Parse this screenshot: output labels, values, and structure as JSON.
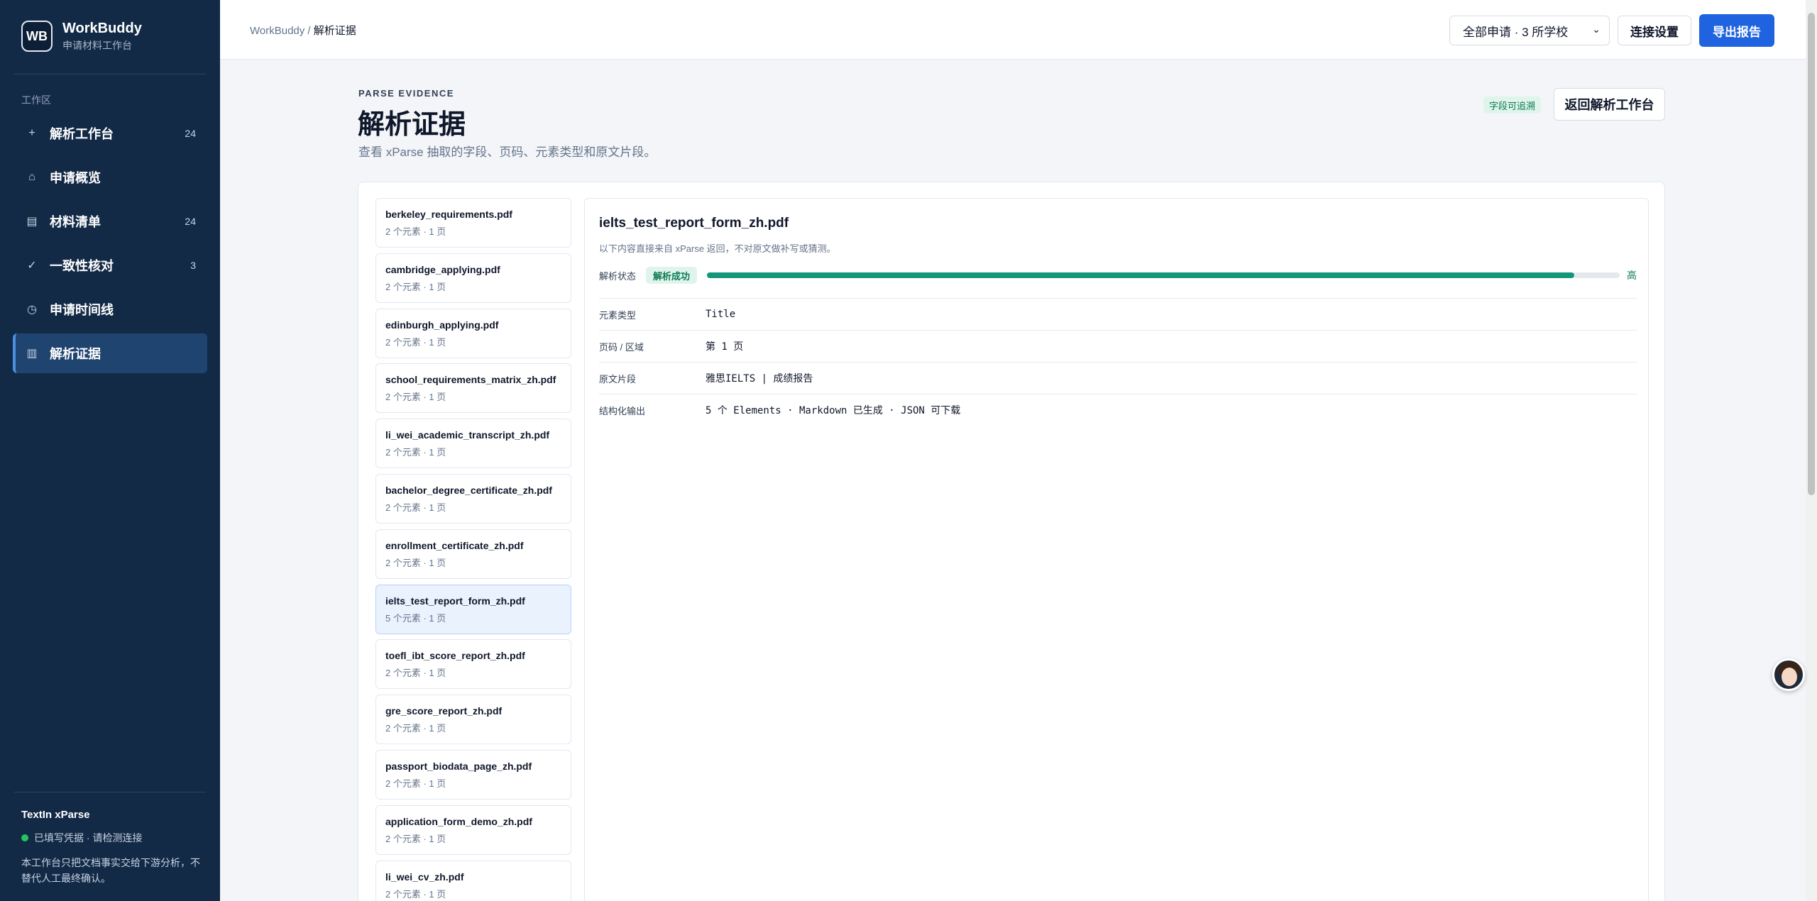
{
  "brand": {
    "logo": "WB",
    "name": "WorkBuddy",
    "subtitle": "申请材料工作台"
  },
  "sidebar": {
    "section_label": "工作区",
    "items": [
      {
        "icon": "plus-icon",
        "glyph": "+",
        "label": "解析工作台",
        "count": "24"
      },
      {
        "icon": "home-icon",
        "glyph": "⌂",
        "label": "申请概览",
        "count": ""
      },
      {
        "icon": "list-icon",
        "glyph": "▤",
        "label": "材料清单",
        "count": "24"
      },
      {
        "icon": "check-icon",
        "glyph": "✓",
        "label": "一致性核对",
        "count": "3"
      },
      {
        "icon": "clock-icon",
        "glyph": "◷",
        "label": "申请时间线",
        "count": ""
      },
      {
        "icon": "columns-icon",
        "glyph": "▥",
        "label": "解析证据",
        "count": ""
      }
    ],
    "footer": {
      "title": "TextIn xParse",
      "status": "已填写凭据 · 请检测连接",
      "note": "本工作台只把文档事实交给下游分析，不替代人工最终确认。"
    }
  },
  "topbar": {
    "breadcrumb_root": "WorkBuddy",
    "breadcrumb_sep": " / ",
    "breadcrumb_current": "解析证据",
    "select_value": "全部申请 · 3 所学校",
    "connect_label": "连接设置",
    "export_label": "导出报告"
  },
  "header": {
    "eyebrow": "PARSE EVIDENCE",
    "title": "解析证据",
    "subtitle": "查看 xParse 抽取的字段、页码、元素类型和原文片段。",
    "badge": "字段可追溯",
    "back_label": "返回解析工作台"
  },
  "files": [
    {
      "name": "berkeley_requirements.pdf",
      "meta": "2 个元素 · 1 页"
    },
    {
      "name": "cambridge_applying.pdf",
      "meta": "2 个元素 · 1 页"
    },
    {
      "name": "edinburgh_applying.pdf",
      "meta": "2 个元素 · 1 页"
    },
    {
      "name": "school_requirements_matrix_zh.pdf",
      "meta": "2 个元素 · 1 页"
    },
    {
      "name": "li_wei_academic_transcript_zh.pdf",
      "meta": "2 个元素 · 1 页"
    },
    {
      "name": "bachelor_degree_certificate_zh.pdf",
      "meta": "2 个元素 · 1 页"
    },
    {
      "name": "enrollment_certificate_zh.pdf",
      "meta": "2 个元素 · 1 页"
    },
    {
      "name": "ielts_test_report_form_zh.pdf",
      "meta": "5 个元素 · 1 页"
    },
    {
      "name": "toefl_ibt_score_report_zh.pdf",
      "meta": "2 个元素 · 1 页"
    },
    {
      "name": "gre_score_report_zh.pdf",
      "meta": "2 个元素 · 1 页"
    },
    {
      "name": "passport_biodata_page_zh.pdf",
      "meta": "2 个元素 · 1 页"
    },
    {
      "name": "application_form_demo_zh.pdf",
      "meta": "2 个元素 · 1 页"
    },
    {
      "name": "li_wei_cv_zh.pdf",
      "meta": "2 个元素 · 1 页"
    }
  ],
  "selected_index": 7,
  "detail": {
    "title": "ielts_test_report_form_zh.pdf",
    "subtitle": "以下内容直接来自 xParse 返回，不对原文做补写或猜测。",
    "status_label": "解析状态",
    "status_value": "解析成功",
    "confidence_fraction": 0.95,
    "confidence_label": "高",
    "rows": [
      {
        "key": "元素类型",
        "value": "Title"
      },
      {
        "key": "页码 / 区域",
        "value": "第 1 页"
      },
      {
        "key": "原文片段",
        "value": "雅思IELTS | 成绩报告"
      },
      {
        "key": "结构化输出",
        "value": "5 个 Elements · Markdown 已生成 · JSON 可下载"
      }
    ]
  },
  "colors": {
    "sidebar": "#132a47",
    "accent": "#1f63e0",
    "success": "#14967a"
  }
}
